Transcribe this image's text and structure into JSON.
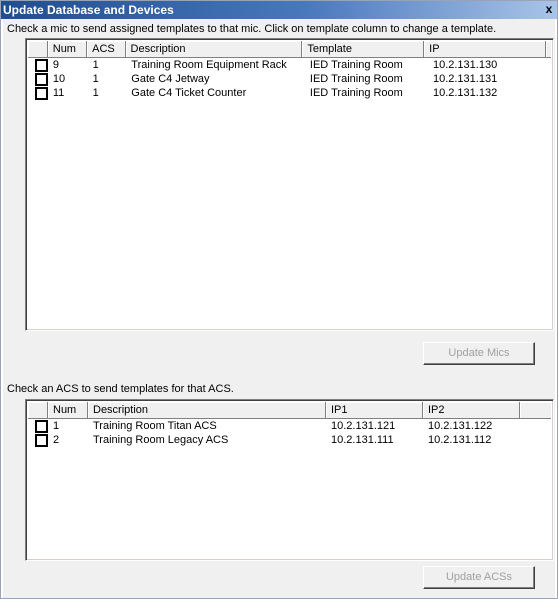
{
  "window": {
    "title": "Update Database and Devices",
    "close_glyph": "x"
  },
  "mics": {
    "instruction": "Check a mic to send assigned templates to that mic.  Click on template column to change a template.",
    "columns": [
      "",
      "Num",
      "ACS",
      "Description",
      "Template",
      "IP"
    ],
    "rows": [
      {
        "num": "9",
        "acs": "1",
        "description": "Training Room Equipment Rack",
        "template": "IED Training Room",
        "ip": "10.2.131.130"
      },
      {
        "num": "10",
        "acs": "1",
        "description": "Gate C4 Jetway",
        "template": "IED Training Room",
        "ip": "10.2.131.131"
      },
      {
        "num": "11",
        "acs": "1",
        "description": "Gate C4 Ticket Counter",
        "template": "IED Training Room",
        "ip": "10.2.131.132"
      }
    ],
    "button": "Update Mics"
  },
  "acs": {
    "instruction": "Check an ACS to send templates for that ACS.",
    "columns": [
      "",
      "Num",
      "Description",
      "IP1",
      "IP2"
    ],
    "rows": [
      {
        "num": "1",
        "description": "Training Room Titan ACS",
        "ip1": "10.2.131.121",
        "ip2": "10.2.131.122"
      },
      {
        "num": "2",
        "description": "Training Room Legacy ACS",
        "ip1": "10.2.131.111",
        "ip2": "10.2.131.112"
      }
    ],
    "button": "Update ACSs"
  }
}
